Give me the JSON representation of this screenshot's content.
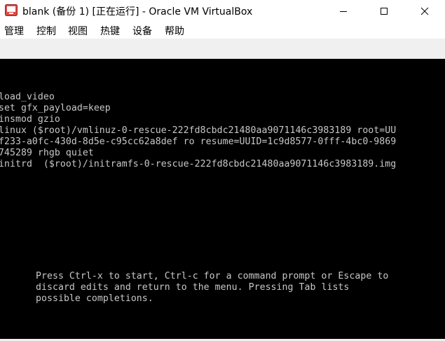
{
  "window": {
    "title": "blank (备份 1) [正在运行] - Oracle VM VirtualBox",
    "minimize_glyph": "—",
    "maximize_glyph": "☐",
    "close_glyph": "✕"
  },
  "menu": {
    "items": [
      "管理",
      "控制",
      "视图",
      "热键",
      "设备",
      "帮助"
    ]
  },
  "grub": {
    "lines": [
      "load_video",
      "set gfx_payload=keep",
      "insmod gzio",
      "linux ($root)/vmlinuz-0-rescue-222fd8cbdc21480aa9071146c3983189 root=UU",
      "f233-a0fc-430d-8d5e-c95cc62a8def ro resume=UUID=1c9d8577-0fff-4bc0-9869",
      "745289 rhgb quiet",
      "initrd  ($root)/initramfs-0-rescue-222fd8cbdc21480aa9071146c3983189.img"
    ],
    "hint": [
      "Press Ctrl-x to start, Ctrl-c for a command prompt or Escape to",
      "discard edits and return to the menu. Pressing Tab lists",
      "possible completions."
    ]
  },
  "colors": {
    "screen_bg": "#000000",
    "terminal_text": "#c8c8c8",
    "toolbar_bg": "#f0f0f0",
    "app_icon": "#d9534f"
  },
  "icons": {
    "app": "virtualbox-app-icon"
  }
}
